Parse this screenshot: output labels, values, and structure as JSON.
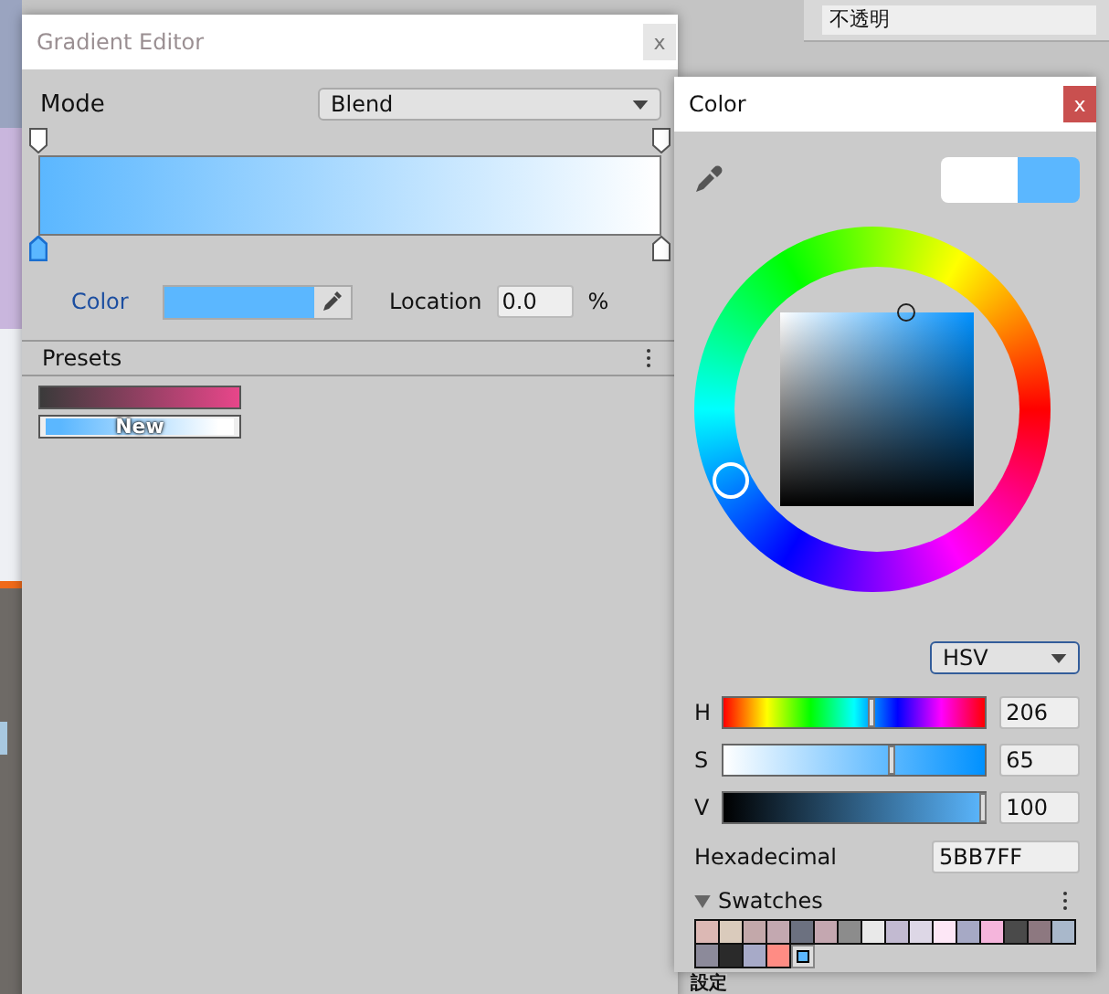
{
  "background": {
    "opacity_field": "不透明",
    "cut_label": "設定"
  },
  "gradient_editor": {
    "title": "Gradient Editor",
    "close": "x",
    "mode_label": "Mode",
    "mode_value": "Blend",
    "alpha_keys": [
      {
        "selected": false
      },
      {
        "selected": false
      }
    ],
    "color_keys": [
      {
        "selected": true,
        "color": "#5bb7ff"
      },
      {
        "selected": false,
        "color": "#ffffff"
      }
    ],
    "color_label": "Color",
    "location_label": "Location",
    "location_value": "0.0",
    "location_unit": "%",
    "presets_title": "Presets",
    "presets": [
      {
        "keys": [
          {
            "color": "#3a3a3a"
          },
          {
            "color": "#e8468a"
          }
        ]
      },
      {
        "keys": [
          {
            "color": "#5bb7ff"
          },
          {
            "color": "#ffffff"
          }
        ],
        "label": "New"
      }
    ]
  },
  "color_window": {
    "title": "Color",
    "close": "x",
    "comparison": [
      {
        "color": "#ffffff"
      },
      {
        "color": "#5bb7ff"
      }
    ],
    "model": "HSV",
    "sliders": [
      {
        "kind": "hue",
        "label": "H",
        "level": 0.572,
        "value": "206"
      },
      {
        "kind": "saturation",
        "label": "S",
        "level": 0.65,
        "value": "65"
      },
      {
        "kind": "value",
        "label": "V",
        "level": 1,
        "value": "100"
      }
    ],
    "hex_label": "Hexadecimal",
    "hex_value": "5BB7FF",
    "swatches_title": "Swatches",
    "swatches": [
      {
        "color": "#dcb8b4",
        "selected": false
      },
      {
        "color": "#dacbbc",
        "selected": false
      },
      {
        "color": "#c3a8aa",
        "selected": false
      },
      {
        "color": "#c3a8b0",
        "selected": false
      },
      {
        "color": "#6c7180",
        "selected": false
      },
      {
        "color": "#c4a7b0",
        "selected": false
      },
      {
        "color": "#8c8c8c",
        "selected": false
      },
      {
        "color": "#e9e9e9",
        "selected": false
      },
      {
        "color": "#c2bad1",
        "selected": false
      },
      {
        "color": "#ddd7e6",
        "selected": false
      },
      {
        "color": "#fde7f6",
        "selected": false
      },
      {
        "color": "#a6a9c5",
        "selected": false
      },
      {
        "color": "#f5b5dc",
        "selected": false
      },
      {
        "color": "#4a4a4a",
        "selected": false
      },
      {
        "color": "#8d7880",
        "selected": false
      },
      {
        "color": "#a9b8cb",
        "selected": false
      },
      {
        "color": "#8c8a9a",
        "selected": false
      },
      {
        "color": "#2a2a2a",
        "selected": false
      },
      {
        "color": "#a7aac8",
        "selected": false
      },
      {
        "color": "#ff8c84",
        "selected": false
      },
      {
        "color": "#5bb7ff",
        "selected": true
      }
    ]
  }
}
